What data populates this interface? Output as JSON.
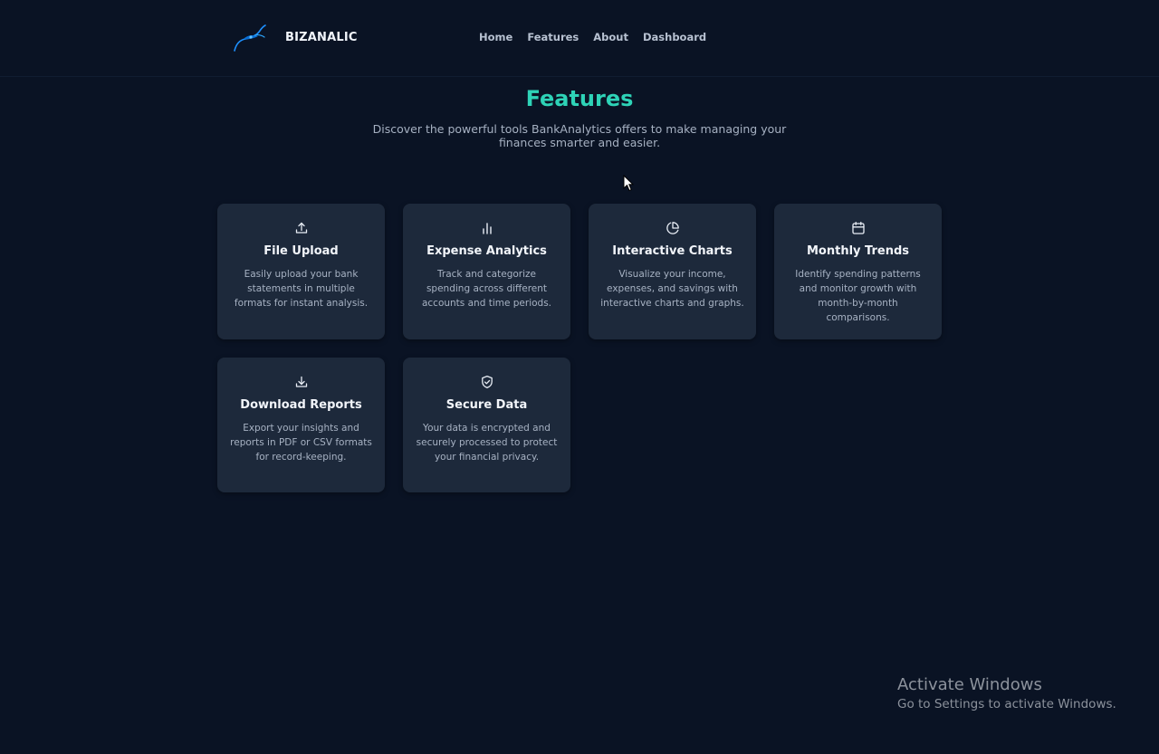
{
  "brand": {
    "name": "BIZANALIC",
    "logo_icon": "bird-swoosh-icon"
  },
  "nav": {
    "items": [
      {
        "label": "Home"
      },
      {
        "label": "Features"
      },
      {
        "label": "About"
      },
      {
        "label": "Dashboard"
      }
    ]
  },
  "page": {
    "title": "Features",
    "subtitle": "Discover the powerful tools BankAnalytics offers to make managing your finances smarter and easier."
  },
  "features": [
    {
      "icon": "upload-icon",
      "title": "File Upload",
      "description": "Easily upload your bank statements in multiple formats for instant analysis."
    },
    {
      "icon": "bar-chart-icon",
      "title": "Expense Analytics",
      "description": "Track and categorize spending across different accounts and time periods."
    },
    {
      "icon": "pie-chart-icon",
      "title": "Interactive Charts",
      "description": "Visualize your income, expenses, and savings with interactive charts and graphs."
    },
    {
      "icon": "calendar-icon",
      "title": "Monthly Trends",
      "description": "Identify spending patterns and monitor growth with month-by-month comparisons."
    },
    {
      "icon": "download-icon",
      "title": "Download Reports",
      "description": "Export your insights and reports in PDF or CSV formats for record-keeping."
    },
    {
      "icon": "shield-check-icon",
      "title": "Secure Data",
      "description": "Your data is encrypted and securely processed to protect your financial privacy."
    }
  ],
  "watermark": {
    "title": "Activate Windows",
    "subtitle": "Go to Settings to activate Windows."
  },
  "colors": {
    "background": "#0a1324",
    "accent": "#2ed3b7",
    "card": "#1d293b"
  }
}
